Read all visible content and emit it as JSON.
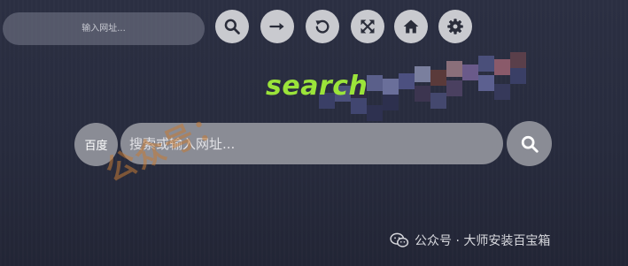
{
  "address_bar": {
    "placeholder": "输入网址..."
  },
  "toolbar": {
    "buttons": [
      {
        "name": "search",
        "icon": "search-icon"
      },
      {
        "name": "go",
        "icon": "arrow-right-icon"
      },
      {
        "name": "refresh",
        "icon": "refresh-icon"
      },
      {
        "name": "fullscreen",
        "icon": "fullscreen-icon"
      },
      {
        "name": "home",
        "icon": "home-icon"
      },
      {
        "name": "settings",
        "icon": "gear-icon"
      }
    ]
  },
  "logo": {
    "text": "search",
    "color": "#9be43a"
  },
  "search": {
    "engine_label": "百度",
    "placeholder": "搜索或输入网址...",
    "submit_icon": "search-icon"
  },
  "watermark": {
    "diagonal_text": "公众号：",
    "footer_text": "公众号 · 大师安装百宝箱",
    "footer_icon": "wechat-icon"
  },
  "colors": {
    "background": "#272b3d",
    "button_light": "#c9cacf",
    "search_fill": "#8a8c95",
    "accent_green": "#9be43a"
  }
}
